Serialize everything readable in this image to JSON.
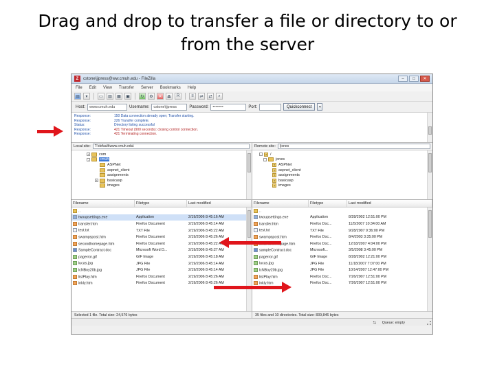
{
  "slide": {
    "title_line1": "Drag and drop to transfer a file or directory to or",
    "title_line2": "from the server"
  },
  "window": {
    "title": "cstone\\jjpress@ww.cmuh.edu - FileZilla",
    "logo_letter": "Z",
    "controls": {
      "minimize": "–",
      "maximize": "□",
      "close": "✕"
    }
  },
  "menu": [
    "File",
    "Edit",
    "View",
    "Transfer",
    "Server",
    "Bookmarks",
    "Help"
  ],
  "quickconnect": {
    "host_label": "Host:",
    "host_value": "www.cmuh.edu",
    "username_label": "Username:",
    "username_value": "cstone\\jjpress",
    "password_label": "Password:",
    "password_value": "••••••••",
    "port_label": "Port:",
    "port_value": "",
    "button_label": "Quickconnect",
    "dropdown_glyph": "▾"
  },
  "log": [
    {
      "key": "Response:",
      "value": "150 Data connection already open; Transfer starting."
    },
    {
      "key": "Response:",
      "value": "226 Transfer complete."
    },
    {
      "key": "Status:",
      "value": "Directory listing successful"
    },
    {
      "key": "Response:",
      "value": "421 Timeout (900 seconds): closing control connection.",
      "error": true
    },
    {
      "key": "Response:",
      "value": "421 Terminating connection.",
      "error": true
    }
  ],
  "local": {
    "site_label": "Local site:",
    "site_path": "T:\\default\\www.cmuh.edu\\",
    "tree": [
      {
        "indent": 3,
        "exp": "+",
        "icon": "folder",
        "label": "com"
      },
      {
        "indent": 3,
        "exp": "-",
        "icon": "folder",
        "label": "cmuh",
        "selected": true
      },
      {
        "indent": 5,
        "exp": "",
        "icon": "folder",
        "label": "ASPNet"
      },
      {
        "indent": 5,
        "exp": "",
        "icon": "folder",
        "label": "aspnet_client"
      },
      {
        "indent": 5,
        "exp": "",
        "icon": "folder",
        "label": "assignments"
      },
      {
        "indent": 5,
        "exp": "+",
        "icon": "folder",
        "label": "basicasp"
      },
      {
        "indent": 5,
        "exp": "",
        "icon": "folder",
        "label": "images"
      }
    ],
    "headers": [
      "Filename",
      "Filetype",
      "Last modified"
    ],
    "files": [
      {
        "icon": "fold",
        "name": "..",
        "type": "",
        "modified": ""
      },
      {
        "icon": "exe",
        "name": "twoupsettings.exe",
        "type": "Application",
        "modified": "2/19/2006 8:45:16 AM",
        "selected": true
      },
      {
        "icon": "htm",
        "name": "transfer.htm",
        "type": "Firefox Document",
        "modified": "2/19/2006 8:45:14 AM"
      },
      {
        "icon": "txt",
        "name": "test.txt",
        "type": "TXT File",
        "modified": "2/19/2006 8:45:22 AM"
      },
      {
        "icon": "htm",
        "name": "swampspost.htm",
        "type": "Firefox Document",
        "modified": "2/19/2006 8:45:26 AM"
      },
      {
        "icon": "htm",
        "name": "secondhomepage.htm",
        "type": "Firefox Document",
        "modified": "2/19/2006 8:45:22 AM"
      },
      {
        "icon": "doc",
        "name": "SampleContract.doc",
        "type": "Microsoft Word D...",
        "modified": "2/19/2006 8:45:27 AM"
      },
      {
        "icon": "img",
        "name": "pagerror.gif",
        "type": "GIF Image",
        "modified": "2/19/2006 8:45:18 AM"
      },
      {
        "icon": "img",
        "name": "lucas.jpg",
        "type": "JPG File",
        "modified": "2/19/2006 8:45:14 AM"
      },
      {
        "icon": "img",
        "name": "lcNBoy20b.jpg",
        "type": "JPG File",
        "modified": "2/19/2006 8:45:14 AM"
      },
      {
        "icon": "htm",
        "name": "listPlay.htm",
        "type": "Firefox Document",
        "modified": "2/19/2006 8:45:26 AM"
      },
      {
        "icon": "htm",
        "name": "inkly.htm",
        "type": "Firefox Document",
        "modified": "2/19/2006 8:45:26 AM"
      }
    ],
    "status": "Selected 1 file. Total size: 24,576 bytes"
  },
  "remote": {
    "site_label": "Remote site:",
    "site_path": "/jones",
    "tree": [
      {
        "indent": 1,
        "exp": "-",
        "icon": "qmark",
        "label": "/"
      },
      {
        "indent": 2,
        "exp": "-",
        "icon": "folder",
        "label": "jones"
      },
      {
        "indent": 3,
        "exp": "",
        "icon": "qmark",
        "label": "ASPNet"
      },
      {
        "indent": 3,
        "exp": "",
        "icon": "qmark",
        "label": "aspnet_client"
      },
      {
        "indent": 3,
        "exp": "",
        "icon": "qmark",
        "label": "assignments"
      },
      {
        "indent": 3,
        "exp": "",
        "icon": "qmark",
        "label": "basicasp"
      },
      {
        "indent": 3,
        "exp": "",
        "icon": "qmark",
        "label": "images"
      }
    ],
    "headers": [
      "Filename",
      "Filetype",
      "Last modified"
    ],
    "files": [
      {
        "icon": "fold",
        "name": "..",
        "type": "",
        "modified": ""
      },
      {
        "icon": "exe",
        "name": "twoupsettings.exe",
        "type": "Application",
        "modified": "8/28/2002 12:51:00 PM"
      },
      {
        "icon": "htm",
        "name": "transfer.htm",
        "type": "Firefox Doc...",
        "modified": "11/5/2007 10:34:00 AM"
      },
      {
        "icon": "txt",
        "name": "test.txt",
        "type": "TXT File",
        "modified": "9/28/2007 9:36:00 PM"
      },
      {
        "icon": "htm",
        "name": "swampspost.htm",
        "type": "Firefox Doc...",
        "modified": "8/4/2003 3:35:00 PM"
      },
      {
        "icon": "htm",
        "name": "secondhomepage.htm",
        "type": "Firefox Doc...",
        "modified": "12/18/2007 4:04:00 PM"
      },
      {
        "icon": "doc",
        "name": "sampleContract.doc",
        "type": "Microsoft...",
        "modified": "3/5/2008 3:45:00 PM"
      },
      {
        "icon": "img",
        "name": "pagerror.gif",
        "type": "GIF Image",
        "modified": "8/28/2002 12:21:00 PM"
      },
      {
        "icon": "img",
        "name": "lucas.jpg",
        "type": "JPG File",
        "modified": "11/18/2007 7:07:00 PM"
      },
      {
        "icon": "img",
        "name": "lcNBoy20b.jpg",
        "type": "JPG File",
        "modified": "10/14/2007 12:47:00 PM"
      },
      {
        "icon": "htm",
        "name": "listPlay.htm",
        "type": "Firefox Doc...",
        "modified": "7/26/2007 12:51:00 PM"
      },
      {
        "icon": "htm",
        "name": "inkly.htm",
        "type": "Firefox Doc...",
        "modified": "7/26/2007 12:51:00 PM"
      }
    ],
    "status": "35 files and 10 directories. Total size: 839,846 bytes"
  },
  "queue": {
    "status": "Queue: empty",
    "icon": "⇆"
  },
  "colors": {
    "arrow": "#e0151b",
    "selection": "#cfe0f7",
    "log_text": "#1f4fa8",
    "log_error": "#b22222"
  }
}
